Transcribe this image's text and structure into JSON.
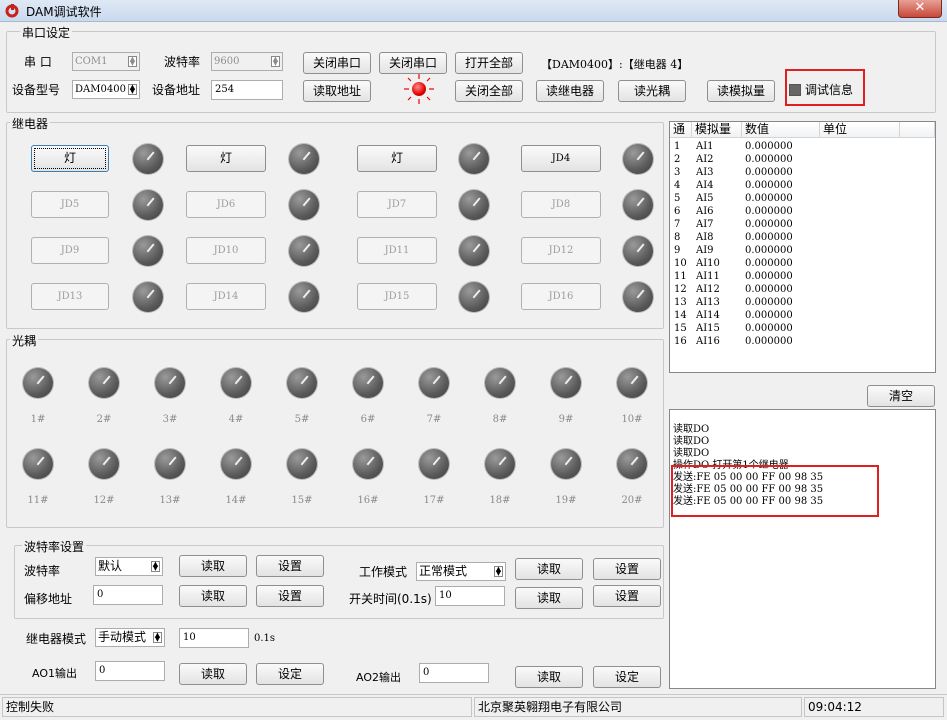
{
  "window": {
    "title": "DAM调试软件",
    "close": "✕"
  },
  "serial": {
    "group_label": "串口设定",
    "port_label": "串  口",
    "port_value": "COM1",
    "baud_label": "波特率",
    "baud_value": "9600",
    "model_label": "设备型号",
    "model_value": "DAM0400",
    "addr_label": "设备地址",
    "addr_value": "254",
    "buttons": {
      "close_port_1": "关闭串口",
      "close_port_2": "关闭串口",
      "open_all": "打开全部",
      "read_addr": "读取地址",
      "close_all": "关闭全部",
      "read_relay": "读继电器",
      "read_opto": "读光耦",
      "read_analog": "读模拟量",
      "debug_info": "调试信息"
    },
    "device_info": "【DAM0400】:【继电器  4】"
  },
  "relay": {
    "group_label": "继电器",
    "buttons": [
      "灯",
      "灯",
      "灯",
      "JD4",
      "JD5",
      "JD6",
      "JD7",
      "JD8",
      "JD9",
      "JD10",
      "JD11",
      "JD12",
      "JD13",
      "JD14",
      "JD15",
      "JD16"
    ]
  },
  "opto": {
    "group_label": "光耦",
    "labels": [
      "1#",
      "2#",
      "3#",
      "4#",
      "5#",
      "6#",
      "7#",
      "8#",
      "9#",
      "10#",
      "11#",
      "12#",
      "13#",
      "14#",
      "15#",
      "16#",
      "17#",
      "18#",
      "19#",
      "20#"
    ]
  },
  "analog_table": {
    "headers": [
      "通",
      "模拟量",
      "数值",
      "单位"
    ],
    "rows": [
      [
        "1",
        "AI1",
        "0.000000",
        ""
      ],
      [
        "2",
        "AI2",
        "0.000000",
        ""
      ],
      [
        "3",
        "AI3",
        "0.000000",
        ""
      ],
      [
        "4",
        "AI4",
        "0.000000",
        ""
      ],
      [
        "5",
        "AI5",
        "0.000000",
        ""
      ],
      [
        "6",
        "AI6",
        "0.000000",
        ""
      ],
      [
        "7",
        "AI7",
        "0.000000",
        ""
      ],
      [
        "8",
        "AI8",
        "0.000000",
        ""
      ],
      [
        "9",
        "AI9",
        "0.000000",
        ""
      ],
      [
        "10",
        "AI10",
        "0.000000",
        ""
      ],
      [
        "11",
        "AI11",
        "0.000000",
        ""
      ],
      [
        "12",
        "AI12",
        "0.000000",
        ""
      ],
      [
        "13",
        "AI13",
        "0.000000",
        ""
      ],
      [
        "14",
        "AI14",
        "0.000000",
        ""
      ],
      [
        "15",
        "AI15",
        "0.000000",
        ""
      ],
      [
        "16",
        "AI16",
        "0.000000",
        ""
      ]
    ]
  },
  "log": {
    "clear_label": "清空",
    "lines": [
      "读取DO",
      "读取DO",
      "读取DO",
      "操作DO  打开第1个继电器",
      "发送:FE 05 00 00 FF 00 98 35",
      "发送:FE 05 00 00 FF 00 98 35",
      "发送:FE 05 00 00 FF 00 98 35"
    ]
  },
  "baud_settings": {
    "group_label": "波特率设置",
    "baud_label": "波特率",
    "baud_value": "默认",
    "offset_label": "偏移地址",
    "offset_value": "0",
    "work_mode_label": "工作模式",
    "work_mode_value": "正常模式",
    "switch_time_label": "开关时间(0.1s)",
    "switch_time_value": "10",
    "read": "读取",
    "set": "设置"
  },
  "relay_mode": {
    "label": "继电器模式",
    "value": "手动模式",
    "time_value": "10",
    "unit": "0.1s"
  },
  "ao": {
    "ao1_label": "AO1输出",
    "ao1_value": "0",
    "ao2_label": "AO2输出",
    "ao2_value": "0",
    "read": "读取",
    "set": "设定"
  },
  "status": {
    "left": "控制失败",
    "company": "北京聚英翱翔电子有限公司",
    "time": "09:04:12"
  },
  "colors": {
    "highlight_box": "#e02020",
    "led": "#e00000"
  }
}
